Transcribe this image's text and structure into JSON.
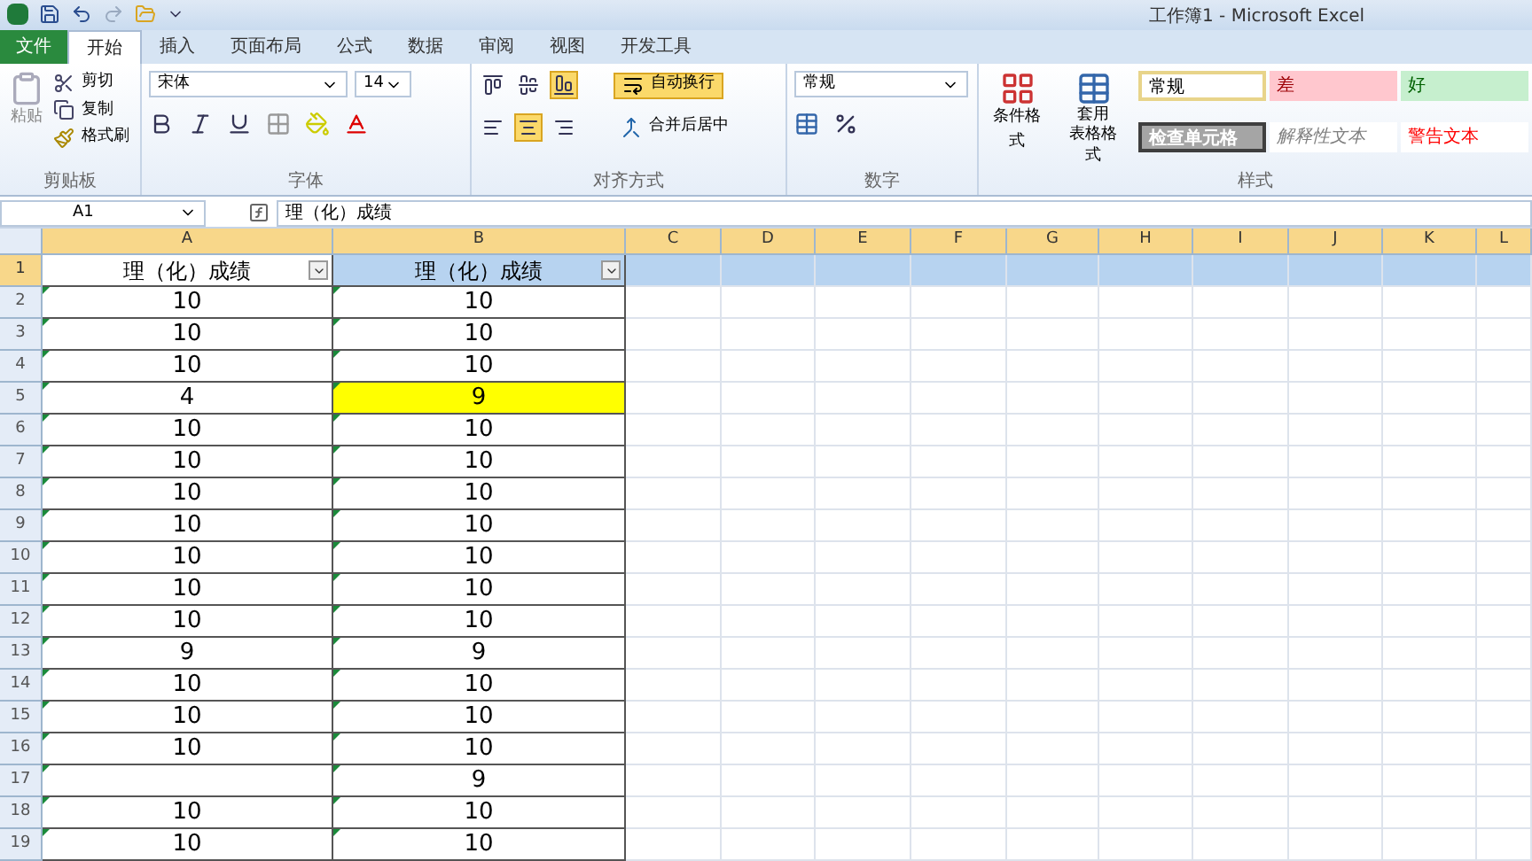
{
  "window": {
    "title": "工作簿1 - Microsoft Excel"
  },
  "tabs": [
    {
      "label": "文件",
      "kind": "file",
      "selected": false
    },
    {
      "label": "开始",
      "kind": "tab",
      "selected": true
    },
    {
      "label": "插入",
      "kind": "tab",
      "selected": false
    },
    {
      "label": "页面布局",
      "kind": "tab",
      "selected": false
    },
    {
      "label": "公式",
      "kind": "tab",
      "selected": false
    },
    {
      "label": "数据",
      "kind": "tab",
      "selected": false
    },
    {
      "label": "审阅",
      "kind": "tab",
      "selected": false
    },
    {
      "label": "视图",
      "kind": "tab",
      "selected": false
    },
    {
      "label": "开发工具",
      "kind": "tab",
      "selected": false
    }
  ],
  "clipboard": {
    "paste": "粘贴",
    "cut": "剪切",
    "copy": "复制",
    "painter": "格式刷",
    "label": "剪贴板"
  },
  "font": {
    "name": "宋体",
    "size": "14",
    "label": "字体"
  },
  "alignment": {
    "top_row": [
      {
        "on": false
      },
      {
        "on": false
      },
      {
        "on": true
      }
    ],
    "bottom_row": [
      {
        "on": false
      },
      {
        "on": true
      },
      {
        "on": false
      }
    ],
    "wrap": {
      "label": "自动换行",
      "on": true
    },
    "merge": "合并后居中",
    "label": "对齐方式"
  },
  "number": {
    "format": "常规",
    "label": "数字"
  },
  "styles": {
    "conditional": "条件格式",
    "table_format": [
      "套用",
      "表格格式"
    ],
    "cells": [
      {
        "label": "常规",
        "kind": "normal"
      },
      {
        "label": "差",
        "kind": "bad"
      },
      {
        "label": "好",
        "kind": "good"
      },
      {
        "label": "检查单元格",
        "kind": "check"
      },
      {
        "label": "解释性文本",
        "kind": "explanatory"
      },
      {
        "label": "警告文本",
        "kind": "warning"
      }
    ],
    "label": "样式"
  },
  "formula_bar": {
    "name_box": "A1",
    "content": "理（化）成绩"
  },
  "columns": [
    {
      "label": "A",
      "selected": true
    },
    {
      "label": "B",
      "selected": true
    },
    {
      "label": "C",
      "selected": true
    },
    {
      "label": "D",
      "selected": true
    },
    {
      "label": "E",
      "selected": true
    },
    {
      "label": "F",
      "selected": true
    },
    {
      "label": "G",
      "selected": true
    },
    {
      "label": "H",
      "selected": true
    },
    {
      "label": "I",
      "selected": true
    },
    {
      "label": "J",
      "selected": true
    },
    {
      "label": "K",
      "selected": true
    },
    {
      "label": "L",
      "selected": true
    }
  ],
  "rows": [
    {
      "number": "1",
      "a": "理（化）成绩",
      "b": "理（化）成绩",
      "selected": true,
      "highlight": false
    },
    {
      "number": "2",
      "a": "10",
      "b": "10",
      "selected": false,
      "highlight": false
    },
    {
      "number": "3",
      "a": "10",
      "b": "10",
      "selected": false,
      "highlight": false
    },
    {
      "number": "4",
      "a": "10",
      "b": "10",
      "selected": false,
      "highlight": false
    },
    {
      "number": "5",
      "a": "4",
      "b": "9",
      "selected": false,
      "highlight": true
    },
    {
      "number": "6",
      "a": "10",
      "b": "10",
      "selected": false,
      "highlight": false
    },
    {
      "number": "7",
      "a": "10",
      "b": "10",
      "selected": false,
      "highlight": false
    },
    {
      "number": "8",
      "a": "10",
      "b": "10",
      "selected": false,
      "highlight": false
    },
    {
      "number": "9",
      "a": "10",
      "b": "10",
      "selected": false,
      "highlight": false
    },
    {
      "number": "10",
      "a": "10",
      "b": "10",
      "selected": false,
      "highlight": false
    },
    {
      "number": "11",
      "a": "10",
      "b": "10",
      "selected": false,
      "highlight": false
    },
    {
      "number": "12",
      "a": "10",
      "b": "10",
      "selected": false,
      "highlight": false
    },
    {
      "number": "13",
      "a": "9",
      "b": "9",
      "selected": false,
      "highlight": false
    },
    {
      "number": "14",
      "a": "10",
      "b": "10",
      "selected": false,
      "highlight": false
    },
    {
      "number": "15",
      "a": "10",
      "b": "10",
      "selected": false,
      "highlight": false
    },
    {
      "number": "16",
      "a": "10",
      "b": "10",
      "selected": false,
      "highlight": false
    },
    {
      "number": "17",
      "b": "9",
      "selected": false,
      "highlight": false
    },
    {
      "number": "18",
      "a": "10",
      "b": "10",
      "selected": false,
      "highlight": false
    },
    {
      "number": "19",
      "a": "10",
      "b": "10",
      "selected": false,
      "highlight": false
    }
  ]
}
